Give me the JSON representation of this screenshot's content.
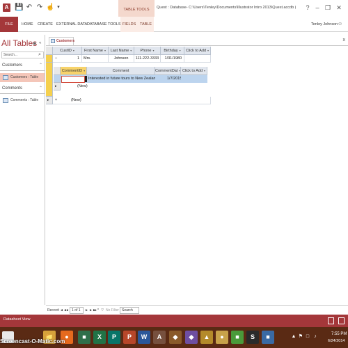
{
  "title_bar": {
    "app_icon": "A",
    "icons": [
      "save-icon",
      "undo-icon",
      "redo-icon",
      "pointer-icon"
    ],
    "contextual_header": "TABLE TOOLS",
    "window_title": "Quest : Database- C:\\Users\\Tenley\\Documents\\Illustrator Intro 2013\\Quest.accdb (Access 2007 - 201...",
    "controls": [
      "?",
      "–",
      "❐",
      "✕"
    ]
  },
  "ribbon": {
    "file_tab": "FILE",
    "tabs": [
      "HOME",
      "CREATE",
      "EXTERNAL DATA",
      "DATABASE TOOLS"
    ],
    "context_tabs": [
      "FIELDS",
      "TABLE"
    ],
    "user_name": "Tenley Johnson",
    "user_icon": "smiley-icon"
  },
  "nav_pane": {
    "title": "All Tables",
    "search_placeholder": "Search...",
    "groups": [
      {
        "header": "Customers",
        "items": [
          {
            "label": "Customers : Table",
            "selected": true
          }
        ]
      },
      {
        "header": "Comments",
        "items": [
          {
            "label": "Comments : Table",
            "selected": false
          }
        ]
      }
    ]
  },
  "document": {
    "tab_label": "Customers",
    "close_glyph": "x",
    "columns": [
      {
        "label": "CustID",
        "has_dropdown": true
      },
      {
        "label": "First Name",
        "has_dropdown": true
      },
      {
        "label": "Last Name",
        "has_dropdown": true
      },
      {
        "label": "Phone",
        "has_dropdown": true
      },
      {
        "label": "Birthday",
        "has_dropdown": true
      },
      {
        "label": "Click to Add",
        "has_dropdown": true
      }
    ],
    "rows": [
      {
        "expander": "−",
        "cells": [
          "1",
          "Mrs.",
          "Johnson",
          "111-222-3333",
          "1/31/1980",
          ""
        ]
      }
    ],
    "new_row": {
      "expander": "+",
      "label": "(New)"
    },
    "subdatasheet": {
      "columns": [
        {
          "label": "CommentID",
          "has_dropdown": true,
          "highlight": true
        },
        {
          "label": "Comment",
          "has_dropdown": false,
          "highlight": false
        },
        {
          "label": "CommentDat",
          "has_dropdown": true,
          "highlight": false
        },
        {
          "label": "Click to Add",
          "has_dropdown": true,
          "highlight": false
        }
      ],
      "rows": [
        {
          "cells": [
            "",
            "Interested in future tours to New Zealand",
            "1/7/2015",
            ""
          ]
        }
      ],
      "new_row_label": "(New)"
    }
  },
  "record_nav": {
    "label": "Record:",
    "first": "◄◄",
    "prev": "◄",
    "position": "1 of 1",
    "next": "►",
    "last": "►►",
    "new": "►*",
    "filter": "No Filter",
    "search": "Search"
  },
  "status_bar": {
    "text": "Datasheet View",
    "color": "#a4373a"
  },
  "taskbar": {
    "watermark": "Screencast-O-Matic.com",
    "apps": [
      {
        "name": "folder-icon",
        "glyph": "📁",
        "color": "#d6a13a"
      },
      {
        "name": "firefox-icon",
        "glyph": "●",
        "color": "#e66a1e"
      },
      {
        "name": "app-icon",
        "glyph": "■",
        "color": "#2f6f4a"
      },
      {
        "name": "excel-icon",
        "glyph": "X",
        "color": "#217346"
      },
      {
        "name": "publisher-icon",
        "glyph": "P",
        "color": "#077568"
      },
      {
        "name": "powerpoint-icon",
        "glyph": "P",
        "color": "#b7472a"
      },
      {
        "name": "word-icon",
        "glyph": "W",
        "color": "#2b579a"
      },
      {
        "name": "access-icon",
        "glyph": "A",
        "color": "#a4373a",
        "active": true
      },
      {
        "name": "app2-icon",
        "glyph": "◆",
        "color": "#8a5a2a"
      },
      {
        "name": "app3-icon",
        "glyph": "◆",
        "color": "#6e4ea1"
      },
      {
        "name": "app4-icon",
        "glyph": "▲",
        "color": "#b48a2a"
      },
      {
        "name": "app5-icon",
        "glyph": "●",
        "color": "#c8a24a"
      },
      {
        "name": "app6-icon",
        "glyph": "■",
        "color": "#4a9a3a"
      },
      {
        "name": "app7-icon",
        "glyph": "S",
        "color": "#2a2a2a"
      },
      {
        "name": "app8-icon",
        "glyph": "■",
        "color": "#3a6aa4"
      },
      {
        "name": "app9-icon",
        "glyph": "▲",
        "color": "#4a7ab4"
      },
      {
        "name": "app10-icon",
        "glyph": "■",
        "color": "#4a4a4a"
      },
      {
        "name": "app11-icon",
        "glyph": "●",
        "color": "#3a3a3a"
      }
    ],
    "tray_icons": [
      "▲",
      "⚑",
      "□",
      "♪"
    ],
    "time": "7:55 PM",
    "date": "6/24/2014"
  }
}
